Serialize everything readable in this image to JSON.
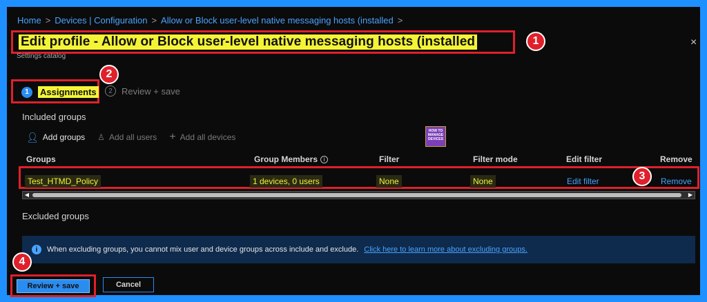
{
  "breadcrumb": {
    "items": [
      "Home",
      "Devices | Configuration",
      "Allow or Block user-level native messaging hosts (installed"
    ],
    "separator": ">"
  },
  "header": {
    "title": "Edit profile - Allow or Block user-level native messaging hosts (installed",
    "subtitle": "Settings catalog",
    "close_glyph": "×"
  },
  "badges": [
    "1",
    "2",
    "3",
    "4"
  ],
  "steps": [
    {
      "number": "1",
      "label": "Assignments",
      "active": true
    },
    {
      "number": "2",
      "label": "Review + save",
      "active": false
    }
  ],
  "included": {
    "heading": "Included groups",
    "toolbar": {
      "add_groups": "Add groups",
      "add_all_users": "Add all users",
      "add_all_devices": "Add all devices"
    },
    "columns": [
      "Groups",
      "Group Members",
      "Filter",
      "Filter mode",
      "Edit filter",
      "Remove"
    ],
    "rows": [
      {
        "group": "Test_HTMD_Policy",
        "members": "1 devices, 0 users",
        "filter": "None",
        "filter_mode": "None",
        "edit_filter": "Edit filter",
        "remove": "Remove"
      }
    ]
  },
  "logo_text": "HOW TO MANAGE DEVICES",
  "excluded": {
    "heading": "Excluded groups",
    "info_text": "When excluding groups, you cannot mix user and device groups across include and exclude.",
    "info_link": "Click here to learn more about excluding groups."
  },
  "footer": {
    "review_save": "Review + save",
    "cancel": "Cancel"
  },
  "colors": {
    "accent": "#2b8cf0",
    "annotation_red": "#e0202a",
    "highlight_yellow": "#f4f437",
    "frame_blue": "#1e90ff"
  }
}
